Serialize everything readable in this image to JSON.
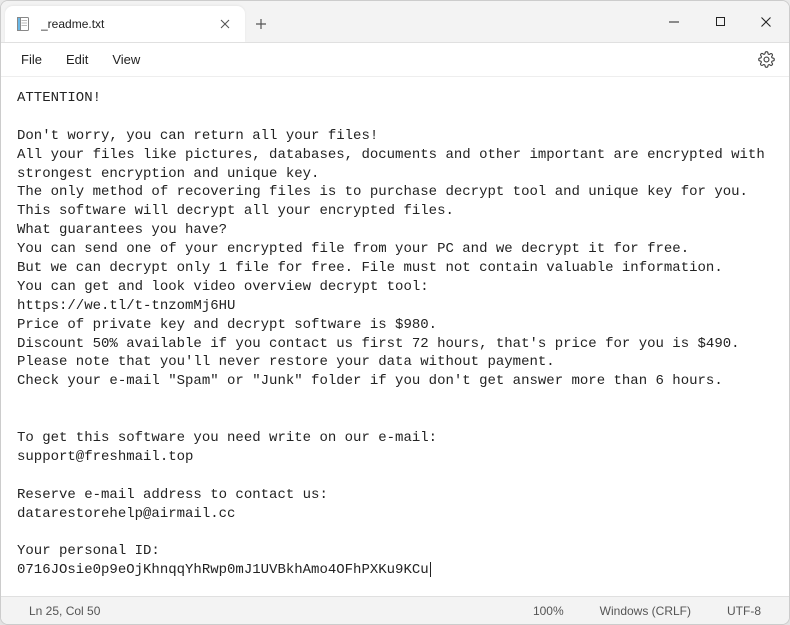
{
  "tab": {
    "title": "_readme.txt"
  },
  "menu": {
    "file": "File",
    "edit": "Edit",
    "view": "View"
  },
  "body": {
    "text": "ATTENTION!\n\nDon't worry, you can return all your files!\nAll your files like pictures, databases, documents and other important are encrypted with strongest encryption and unique key.\nThe only method of recovering files is to purchase decrypt tool and unique key for you.\nThis software will decrypt all your encrypted files.\nWhat guarantees you have?\nYou can send one of your encrypted file from your PC and we decrypt it for free.\nBut we can decrypt only 1 file for free. File must not contain valuable information.\nYou can get and look video overview decrypt tool:\nhttps://we.tl/t-tnzomMj6HU\nPrice of private key and decrypt software is $980.\nDiscount 50% available if you contact us first 72 hours, that's price for you is $490.\nPlease note that you'll never restore your data without payment.\nCheck your e-mail \"Spam\" or \"Junk\" folder if you don't get answer more than 6 hours.\n\n\nTo get this software you need write on our e-mail:\nsupport@freshmail.top\n\nReserve e-mail address to contact us:\ndatarestorehelp@airmail.cc\n\nYour personal ID:\n0716JOsie0p9eOjKhnqqYhRwp0mJ1UVBkhAmo4OFhPXKu9KCu"
  },
  "status": {
    "position": "Ln 25, Col 50",
    "zoom": "100%",
    "line_endings": "Windows (CRLF)",
    "encoding": "UTF-8"
  }
}
